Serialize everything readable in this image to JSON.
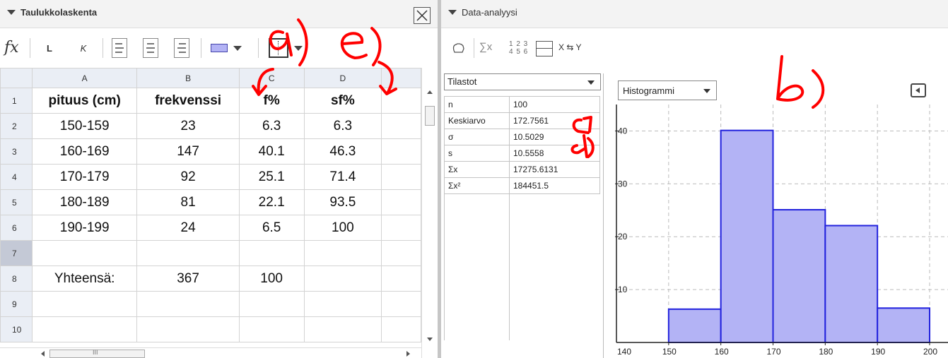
{
  "spreadsheet": {
    "title": "Taulukkolaskenta",
    "toolbar": {
      "fx": "fx",
      "bold": "L",
      "italic": "K"
    },
    "columns": [
      "A",
      "B",
      "C",
      "D"
    ],
    "rows": [
      {
        "num": "1",
        "cells": [
          "pituus (cm)",
          "frekvenssi",
          "f%",
          "sf%"
        ],
        "bold": true
      },
      {
        "num": "2",
        "cells": [
          "150-159",
          "23",
          "6.3",
          "6.3"
        ]
      },
      {
        "num": "3",
        "cells": [
          "160-169",
          "147",
          "40.1",
          "46.3"
        ]
      },
      {
        "num": "4",
        "cells": [
          "170-179",
          "92",
          "25.1",
          "71.4"
        ]
      },
      {
        "num": "5",
        "cells": [
          "180-189",
          "81",
          "22.1",
          "93.5"
        ]
      },
      {
        "num": "6",
        "cells": [
          "190-199",
          "24",
          "6.5",
          "100"
        ]
      },
      {
        "num": "7",
        "cells": [
          "",
          "",
          "",
          ""
        ],
        "selected": true
      },
      {
        "num": "8",
        "cells": [
          "Yhteensä:",
          "367",
          "100",
          ""
        ]
      },
      {
        "num": "9",
        "cells": [
          "",
          "",
          "",
          ""
        ]
      },
      {
        "num": "10",
        "cells": [
          "",
          "",
          "",
          ""
        ]
      }
    ],
    "hscroll_thumb_mark": "III"
  },
  "analysis": {
    "title": "Data-analyysi",
    "toolbar": {
      "sigma_label": "∑x",
      "matrix_top": "1 2 3",
      "matrix_bottom": "4 5 6",
      "swap_label": "X ⇆ Y"
    },
    "stats_dropdown": "Tilastot",
    "stats": [
      {
        "key": "n",
        "value": "100"
      },
      {
        "key": "Keskiarvo",
        "value": "172.7561"
      },
      {
        "key": "σ",
        "value": "10.5029"
      },
      {
        "key": "s",
        "value": "10.5558"
      },
      {
        "key": "Σx",
        "value": "17275.6131"
      },
      {
        "key": "Σx²",
        "value": "184451.5"
      }
    ],
    "chart_dropdown": "Histogrammi"
  },
  "colors": {
    "bar_fill": "#b3b3f5",
    "bar_stroke": "#2222dd",
    "annotation": "#ff0000"
  },
  "chart_data": {
    "type": "bar",
    "bins": [
      [
        150,
        160
      ],
      [
        160,
        170
      ],
      [
        170,
        180
      ],
      [
        180,
        190
      ],
      [
        190,
        200
      ]
    ],
    "values": [
      6.3,
      40.1,
      25.1,
      22.1,
      6.5
    ],
    "xlim": [
      140,
      200
    ],
    "ylim": [
      0,
      45
    ],
    "xticks": [
      "140",
      "150",
      "160",
      "170",
      "180",
      "190",
      "200"
    ],
    "yticks": [
      "10",
      "20",
      "30",
      "40"
    ],
    "grid": true
  },
  "annotations": {
    "a": "a)",
    "b": "b)",
    "c": "c)",
    "d": "d)",
    "e": "e)"
  }
}
